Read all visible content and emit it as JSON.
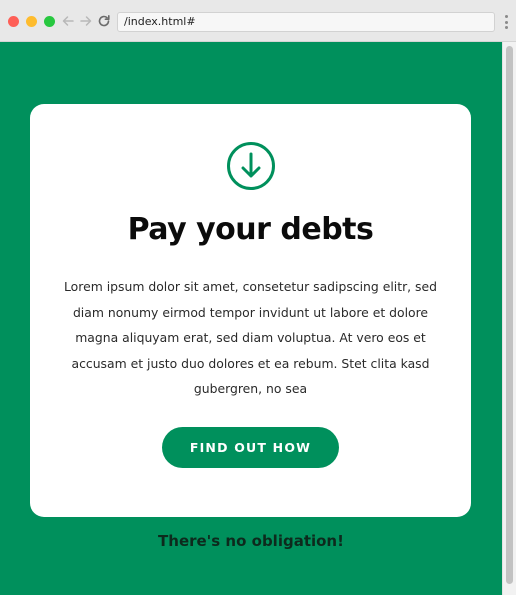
{
  "browser": {
    "url": "/index.html#",
    "icons": {
      "back": "arrow-left-icon",
      "forward": "arrow-right-icon",
      "reload": "reload-icon",
      "menu": "more-vertical-icon"
    }
  },
  "card": {
    "icon": "arrow-down-circle-icon",
    "title": "Pay your debts",
    "body": "Lorem ipsum dolor sit amet, consetetur sadipscing elitr, sed diam nonumy eirmod tempor invidunt ut labore et dolore magna aliquyam erat, sed diam voluptua. At vero eos et accusam et justo duo dolores et ea rebum. Stet clita kasd gubergren, no sea",
    "cta_label": "FIND OUT HOW"
  },
  "footnote": "There's no obligation!",
  "colors": {
    "brand_green": "#00905c",
    "card_bg": "#ffffff",
    "title": "#0b0b0b"
  }
}
